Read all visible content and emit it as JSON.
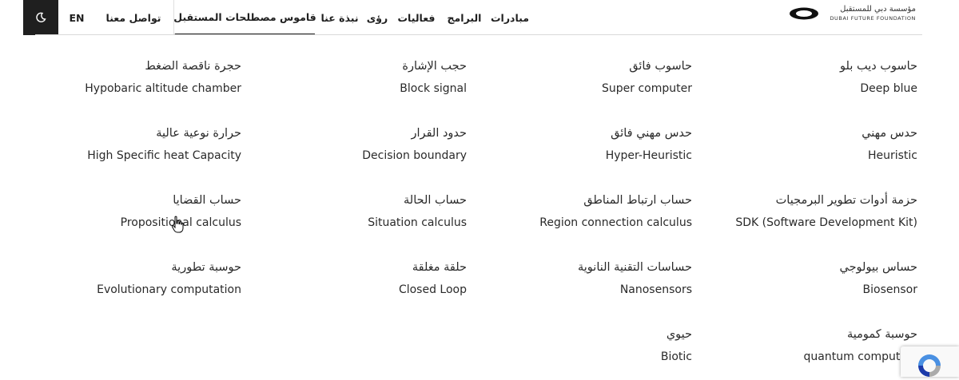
{
  "header": {
    "logo": {
      "arabic": "مؤسسة دبي للمستقبل",
      "english": "DUBAI FUTURE FOUNDATION"
    },
    "nav": [
      {
        "label": "مبادرات"
      },
      {
        "label": "البرامج"
      },
      {
        "label": "فعاليات"
      },
      {
        "label": "رؤى"
      },
      {
        "label": "نبذة عنا"
      },
      {
        "label": "قاموس مصطلحات المستقبل",
        "active": true
      },
      {
        "label": "تواصل معنا"
      },
      {
        "label": "EN"
      }
    ],
    "theme_toggle_icon": "moon-icon"
  },
  "terms": [
    {
      "ar": "حاسوب ديب بلو",
      "en": "Deep blue"
    },
    {
      "ar": "حاسوب فائق",
      "en": "Super computer"
    },
    {
      "ar": "حجب الإشارة",
      "en": "Block signal"
    },
    {
      "ar": "حجرة ناقصة الضغط",
      "en": "Hypobaric altitude chamber"
    },
    {
      "ar": "حدس مهني",
      "en": "Heuristic"
    },
    {
      "ar": "حدس مهني فائق",
      "en": "Hyper-Heuristic"
    },
    {
      "ar": "حدود القرار",
      "en": "Decision boundary"
    },
    {
      "ar": "حرارة نوعية عالية",
      "en": "High Specific heat Capacity"
    },
    {
      "ar": "حزمة أدوات تطوير البرمجيات",
      "en": "SDK (Software Development Kit)"
    },
    {
      "ar": "حساب ارتباط المناطق",
      "en": "Region connection calculus"
    },
    {
      "ar": "حساب الحالة",
      "en": "Situation calculus"
    },
    {
      "ar": "حساب القضايا",
      "en": "Propositional calculus"
    },
    {
      "ar": "حساس بيولوجي",
      "en": "Biosensor"
    },
    {
      "ar": "حساسات التقنية النانوية",
      "en": "Nanosensors"
    },
    {
      "ar": "حلقة مغلقة",
      "en": "Closed Loop"
    },
    {
      "ar": "حوسبة تطورية",
      "en": "Evolutionary computation"
    },
    {
      "ar": "حوسبة كمومية",
      "en": "quantum computing"
    },
    {
      "ar": "حيوي",
      "en": "Biotic"
    }
  ],
  "colors": {
    "text": "#2a2a2a",
    "dark": "#1f1f1f",
    "divider": "#d9d9d9",
    "recaptcha_blue": "#4a90e2"
  }
}
